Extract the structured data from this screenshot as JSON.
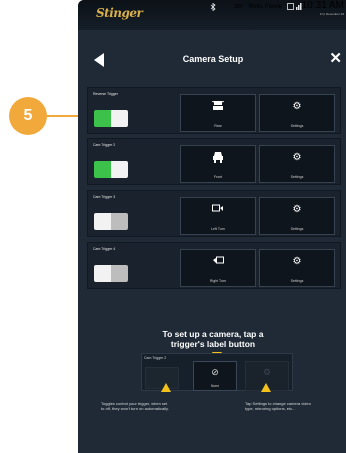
{
  "statusbar": {
    "logo": "Stinger",
    "temp": "185°",
    "bluetooth_icon": "bluetooth-icon",
    "phone": "Robs Phone",
    "battery_icon": "battery-icon",
    "signal_icon": "signal-icon",
    "time": "10:31 AM",
    "date": "Fri | December 29"
  },
  "header": {
    "title": "Camera Setup",
    "back_icon": "back-arrow-icon",
    "close_icon": "close-icon"
  },
  "rows": [
    {
      "title": "Reverse Trigger",
      "toggle_on": true,
      "tile1_icon": "rear-camera-icon",
      "tile1_label": "Rear",
      "tile2_label": "Settings"
    },
    {
      "title": "Cam Trigger 2",
      "toggle_on": true,
      "tile1_icon": "front-camera-icon",
      "tile1_label": "Front",
      "tile2_label": "Settings"
    },
    {
      "title": "Cam Trigger 3",
      "toggle_on": false,
      "tile1_icon": "left-turn-camera-icon",
      "tile1_label": "Left Turn",
      "tile2_label": "Settings"
    },
    {
      "title": "Cam Trigger 4",
      "toggle_on": false,
      "tile1_icon": "right-turn-camera-icon",
      "tile1_label": "Right Turn",
      "tile2_label": "Settings"
    }
  ],
  "info": {
    "title_line1": "To set up a camera, tap a",
    "title_line2": "trigger's label button",
    "mini_label": "Cam Trigger 2",
    "mini_tile_label": "None",
    "hint_left_line1": "Toggles control your trigger, when set",
    "hint_left_line2": "to off, they won't turn on automatically.",
    "hint_right_line1": "Tap Settings to change camera video",
    "hint_right_line2": "type, mirroring options, etc..."
  },
  "callout": {
    "number": "5"
  },
  "colors": {
    "toggle_on": "#3cc14a",
    "toggle_off": "#f2f2f2",
    "accent": "#f2c21a",
    "callout": "#f2a93b"
  }
}
